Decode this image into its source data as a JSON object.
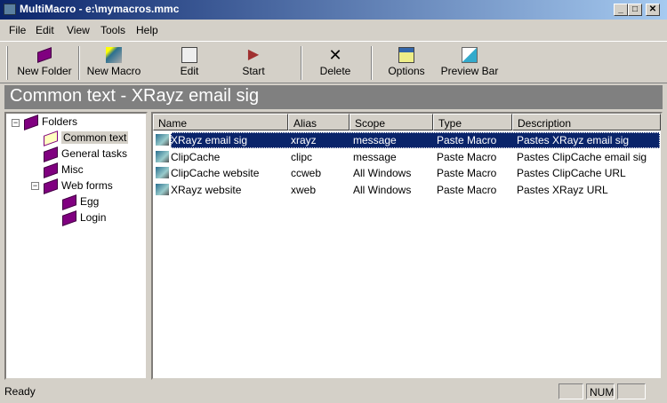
{
  "window": {
    "title": "MultiMacro - e:\\mymacros.mmc",
    "minimize": "_",
    "maximize": "□",
    "close": "✕"
  },
  "menu": [
    "File",
    "Edit",
    "View",
    "Tools",
    "Help"
  ],
  "toolbar": {
    "new_folder": "New Folder",
    "new_macro": "New Macro",
    "edit": "Edit",
    "start": "Start",
    "delete": "Delete",
    "options": "Options",
    "preview_bar": "Preview Bar",
    "dropdown": "▼"
  },
  "banner": "Common text - XRayz email sig",
  "tree": {
    "root": "Folders",
    "items": [
      "Common text",
      "General tasks",
      "Misc",
      "Web forms"
    ],
    "children": [
      "Egg",
      "Login"
    ],
    "expander": "−"
  },
  "list": {
    "columns": [
      "Name",
      "Alias",
      "Scope",
      "Type",
      "Description"
    ],
    "rows": [
      [
        "XRayz email sig",
        "xrayz",
        "message",
        "Paste Macro",
        "Pastes XRayz email sig"
      ],
      [
        "ClipCache",
        "clipc",
        "message",
        "Paste Macro",
        "Pastes ClipCache email sig"
      ],
      [
        "ClipCache website",
        "ccweb",
        "All Windows",
        "Paste Macro",
        "Pastes ClipCache URL"
      ],
      [
        "XRayz website",
        "xweb",
        "All Windows",
        "Paste Macro",
        "Pastes XRayz URL"
      ]
    ]
  },
  "status": {
    "text": "Ready",
    "num": "NUM"
  }
}
